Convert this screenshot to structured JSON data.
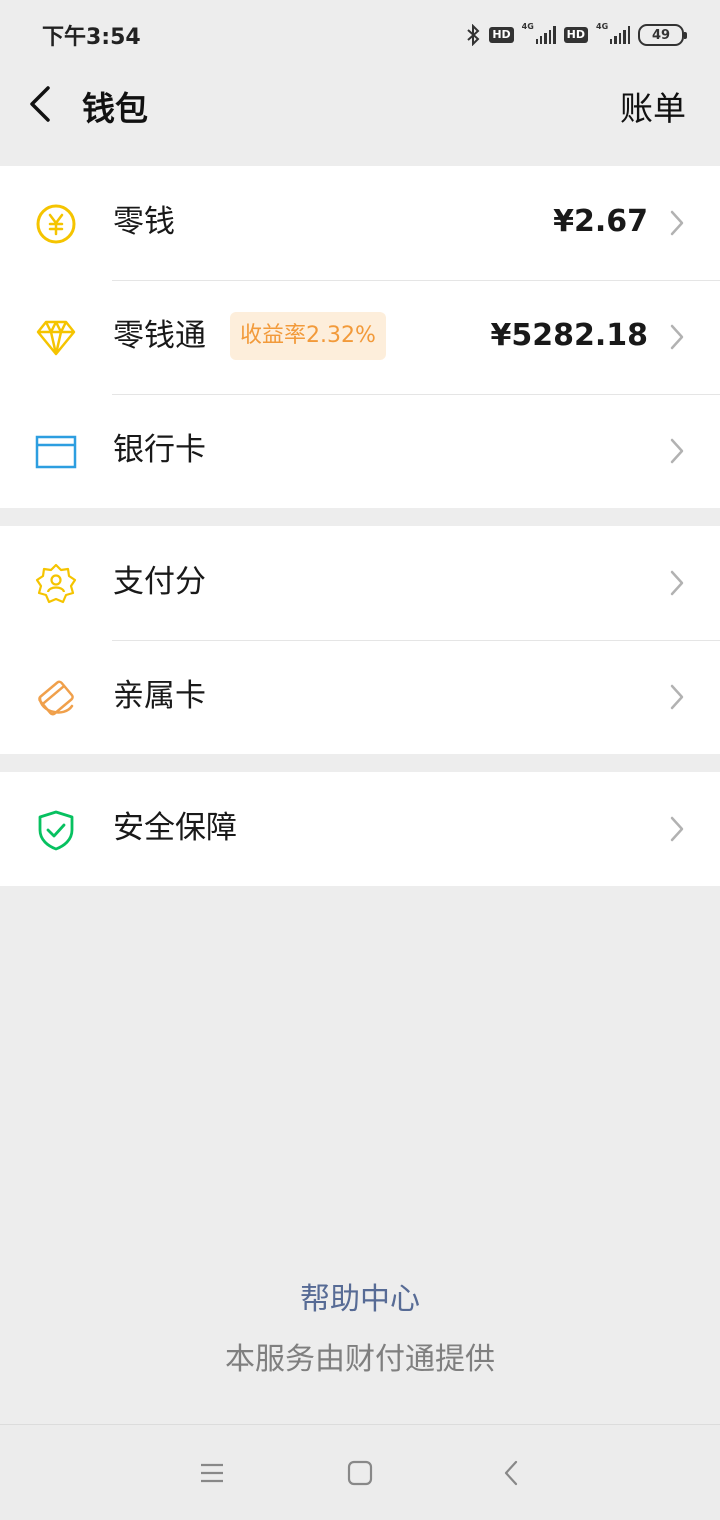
{
  "status_bar": {
    "time": "下午3:54",
    "hd_1": "HD",
    "hd_2": "HD",
    "network_1": "4G",
    "network_2": "4G",
    "battery": "49"
  },
  "header": {
    "title": "钱包",
    "right_link": "账单"
  },
  "groups": [
    {
      "rows": [
        {
          "label": "零钱",
          "value": "¥2.67",
          "icon": "yuan-coin-icon"
        },
        {
          "label": "零钱通",
          "badge": "收益率2.32%",
          "value": "¥5282.18",
          "icon": "diamond-icon"
        },
        {
          "label": "银行卡",
          "icon": "bank-card-icon"
        }
      ]
    },
    {
      "rows": [
        {
          "label": "支付分",
          "icon": "pay-score-icon"
        },
        {
          "label": "亲属卡",
          "icon": "family-card-icon"
        }
      ]
    },
    {
      "rows": [
        {
          "label": "安全保障",
          "icon": "security-shield-icon"
        }
      ]
    }
  ],
  "footer": {
    "help": "帮助中心",
    "provider": "本服务由财付通提供"
  },
  "colors": {
    "background": "#ededed",
    "link": "#576b95",
    "yellow_icon": "#f5c400",
    "orange_badge_text": "#f29a3a",
    "blue_icon": "#2d9ee0",
    "green_icon": "#07c160"
  }
}
